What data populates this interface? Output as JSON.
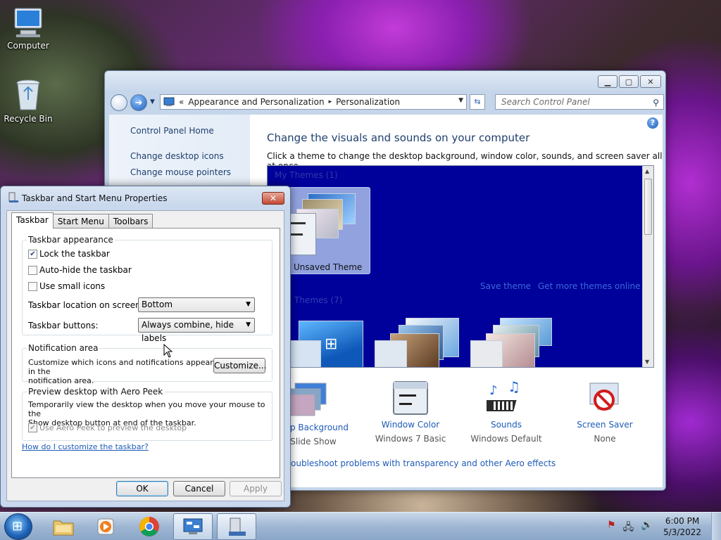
{
  "desktop": {
    "icons": [
      {
        "label": "Computer",
        "icon": "computer-icon"
      },
      {
        "label": "Recycle Bin",
        "icon": "recycle-bin-icon"
      }
    ]
  },
  "control_panel": {
    "address": {
      "chevron": "«",
      "segments": [
        "Appearance and Personalization",
        "Personalization"
      ],
      "separator": "▸"
    },
    "search_placeholder": "Search Control Panel",
    "left_links": [
      "Control Panel Home",
      "Change desktop icons",
      "Change mouse pointers"
    ],
    "title": "Change the visuals and sounds on your computer",
    "subtitle": "Click a theme to change the desktop background, window color, sounds, and screen saver all at once.",
    "my_themes_header": "My Themes (1)",
    "unsaved_theme_label": "Unsaved Theme",
    "save_theme": "Save theme",
    "get_more_themes": "Get more themes online",
    "aero_themes_header": "Themes (7)",
    "bottom_items": [
      {
        "name": "ktop Background",
        "value": "Slide Show",
        "icon": "desktop-background-icon"
      },
      {
        "name": "Window Color",
        "value": "Windows 7 Basic",
        "icon": "window-color-icon"
      },
      {
        "name": "Sounds",
        "value": "Windows Default",
        "icon": "sounds-icon"
      },
      {
        "name": "Screen Saver",
        "value": "None",
        "icon": "screen-saver-icon"
      }
    ],
    "troubleshoot_link": "oubleshoot problems with transparency and other Aero effects"
  },
  "dialog": {
    "title": "Taskbar and Start Menu Properties",
    "close_label": "✕",
    "tabs": [
      "Taskbar",
      "Start Menu",
      "Toolbars"
    ],
    "appearance": {
      "legend": "Taskbar appearance",
      "lock": {
        "label": "Lock the taskbar",
        "checked": true
      },
      "autohide": {
        "label": "Auto-hide the taskbar",
        "checked": false
      },
      "small_icons": {
        "label": "Use small icons",
        "checked": false
      },
      "location_label": "Taskbar location on screen:",
      "location_value": "Bottom",
      "buttons_label": "Taskbar buttons:",
      "buttons_value": "Always combine, hide labels"
    },
    "notification": {
      "legend": "Notification area",
      "desc_line1": "Customize which icons and notifications appear in the",
      "desc_line2": "notification area.",
      "customize_button": "Customize..."
    },
    "aero_peek": {
      "legend": "Preview desktop with Aero Peek",
      "desc_line1": "Temporarily view the desktop when you move your mouse to the",
      "desc_line2": "Show desktop button at end of the taskbar.",
      "checkbox_label": "Use Aero Peek to preview the desktop"
    },
    "help_link": "How do I customize the taskbar?",
    "ok": "OK",
    "cancel": "Cancel",
    "apply": "Apply"
  },
  "taskbar": {
    "items": [
      "explorer-icon",
      "media-player-icon",
      "chrome-icon",
      "control-panel-icon",
      "taskbar-properties-icon"
    ],
    "clock_time": "6:00 PM",
    "clock_date": "5/3/2022"
  }
}
